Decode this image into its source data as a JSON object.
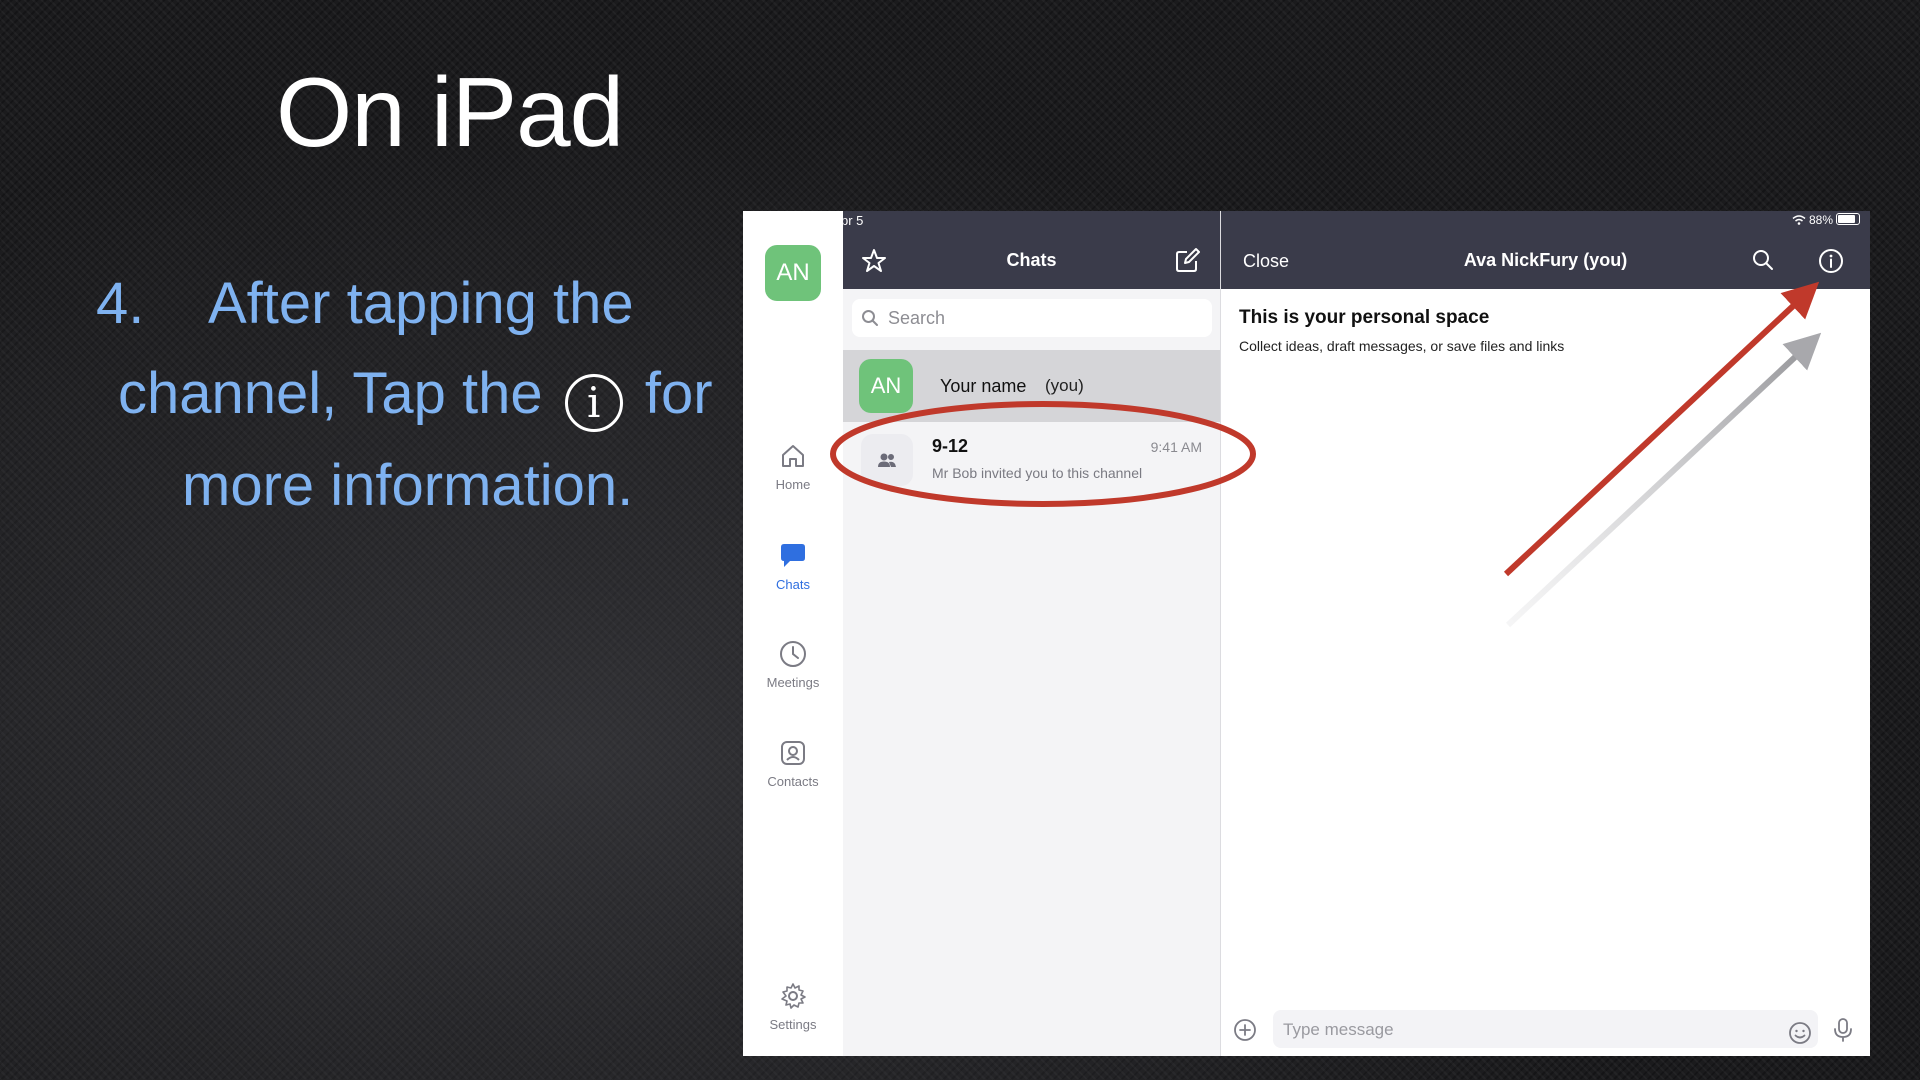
{
  "slide": {
    "title": "On iPad",
    "step_number": "4.",
    "step_line1": "After tapping the",
    "step_line2_a": "channel, Tap the",
    "info_glyph": "i",
    "step_line2_b": "for",
    "step_line3": "more information."
  },
  "status_bar": {
    "date": "pr 5",
    "battery": "88%"
  },
  "sidebar": {
    "avatar_initials": "AN",
    "items": [
      {
        "label": "Home",
        "icon": "home-icon"
      },
      {
        "label": "Chats",
        "icon": "chat-bubble-icon",
        "active": true
      },
      {
        "label": "Meetings",
        "icon": "clock-icon"
      },
      {
        "label": "Contacts",
        "icon": "contact-card-icon"
      },
      {
        "label": "Settings",
        "icon": "gear-icon"
      }
    ]
  },
  "chats": {
    "title": "Chats",
    "search_placeholder": "Search",
    "self_row": {
      "initials": "AN",
      "name": "Your name",
      "suffix": "(you)"
    },
    "channel": {
      "name": "9-12",
      "time": "9:41 AM",
      "subtitle": "Mr Bob invited you to this channel"
    }
  },
  "conversation": {
    "close_label": "Close",
    "title": "Ava NickFury (you)",
    "personal_title": "This is your personal space",
    "personal_subtitle": "Collect ideas, draft messages, or save files and links",
    "message_placeholder": "Type message"
  },
  "colors": {
    "accent_blue": "#2f6fe0",
    "header_bg": "#3a3b4a",
    "avatar_green": "#6fc37a",
    "annotation_red": "#c0392b",
    "step_text_blue": "#7fb2f0"
  }
}
